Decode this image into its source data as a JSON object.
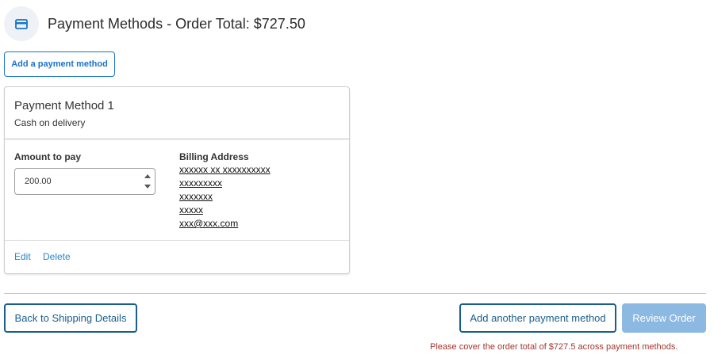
{
  "header": {
    "icon": "credit-card-icon",
    "title": "Payment Methods - Order Total: $727.50",
    "icon_color": "#1a73c9"
  },
  "actions": {
    "add_top_label": "Add a payment method",
    "back_label": "Back to Shipping Details",
    "add_another_label": "Add another payment method",
    "review_label": "Review Order"
  },
  "payment_method": {
    "title": "Payment Method 1",
    "type": "Cash on delivery",
    "amount_label": "Amount to pay",
    "amount_value": "200.00",
    "billing_label": "Billing Address",
    "billing_lines": [
      "xxxxxx xx xxxxxxxxxx",
      "xxxxxxxxx",
      "xxxxxxx",
      "xxxxx",
      "xxx@xxx.com"
    ],
    "edit_label": "Edit",
    "delete_label": "Delete"
  },
  "warning": "Please cover the order total of $727.5 across payment methods.",
  "colors": {
    "primary": "#1a73c9",
    "dark_primary": "#1a5e8c",
    "link": "#2b87c8",
    "disabled_button": "#8bb9e2",
    "error": "#a5352a"
  }
}
